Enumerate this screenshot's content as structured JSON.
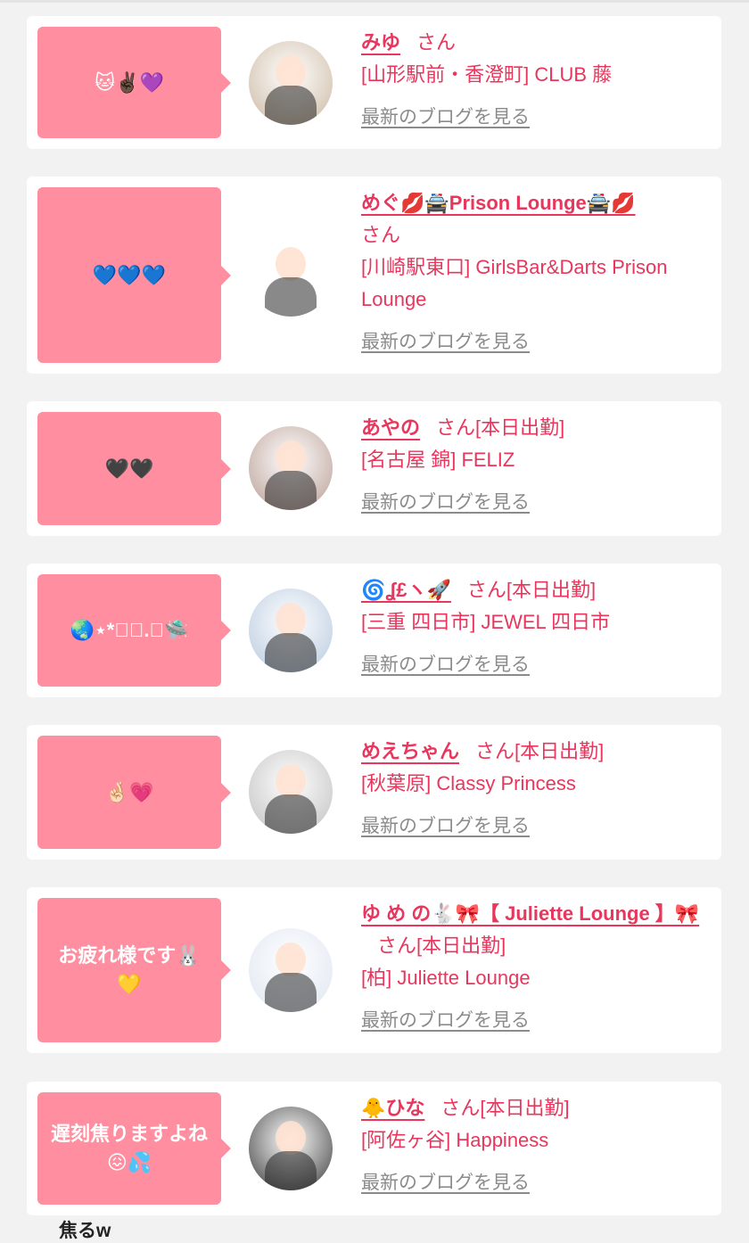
{
  "colors": {
    "bubble": "#ff8fa0",
    "name_link": "#e8365d",
    "blog_link": "#8b8b8b",
    "background": "#f2f2f2"
  },
  "cards": [
    {
      "bubble": "🐱✌🏿💜",
      "name": "みゆ",
      "san": "さん",
      "status": "",
      "shop": "[山形駅前・香澄町] CLUB 藤",
      "blog": "最新のブログを見る",
      "avatar_tone": "#d8c9b8"
    },
    {
      "bubble": "💙💙💙",
      "name": "めぐ💋🚔Prison Lounge🚔💋",
      "san": "さん",
      "status": "",
      "shop": "[川崎駅東口] GirlsBar&Darts Prison Lounge",
      "blog": "最新のブログを見る",
      "avatar_tone": "#ffffff"
    },
    {
      "bubble": "🖤🖤",
      "name": "あやの",
      "san": "さん",
      "status": "[本日出勤]",
      "shop": "[名古屋 錦] FELIZ",
      "blog": "最新のブログを見る",
      "avatar_tone": "#c9b4ad"
    },
    {
      "bubble": "🌏⋆*ﾟ･.｡🛸",
      "name": "🌀ʆ£ヽ🚀",
      "san": "さん",
      "status": "[本日出勤]",
      "shop": "[三重 四日市] JEWEL 四日市",
      "blog": "最新のブログを見る",
      "avatar_tone": "#c8d6e6"
    },
    {
      "bubble": "🤞🏻💗",
      "name": "めえちゃん",
      "san": "さん",
      "status": "[本日出勤]",
      "shop": "[秋葉原] Classy Princess",
      "blog": "最新のブログを見る",
      "avatar_tone": "#cfcfcf"
    },
    {
      "bubble": "お疲れ様です🐰💛",
      "name": "ゆ め の🐇🎀【 Juliette Lounge 】🎀",
      "san": "さん",
      "status": "[本日出勤]",
      "shop": "[柏] Juliette Lounge",
      "blog": "最新のブログを見る",
      "avatar_tone": "#e6ecf4"
    },
    {
      "bubble": "遅刻焦りますよね😖💦",
      "name": "🐥ひな",
      "san": "さん",
      "status": "[本日出勤]",
      "shop": "[阿佐ヶ谷] Happiness",
      "blog": "最新のブログを見る",
      "avatar_tone": "#6a6a6a"
    }
  ],
  "footnote": "焦るw"
}
